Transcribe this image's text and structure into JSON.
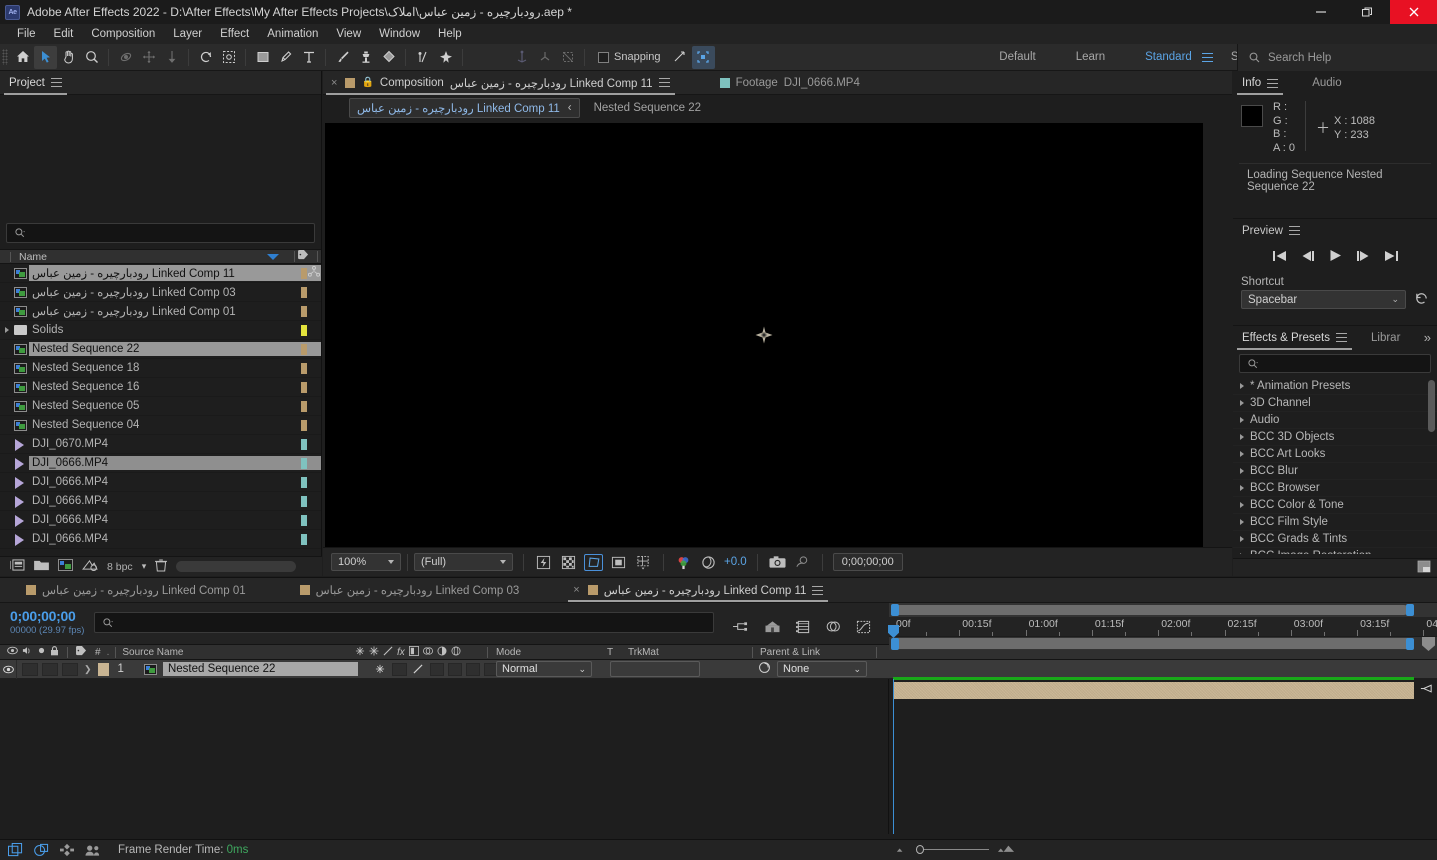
{
  "window": {
    "title": "Adobe After Effects 2022 - D:\\After Effects\\My After Effects Projects\\رودبارچیره - زمین عباس\\املاک.aep *",
    "logo": "Ae",
    "minimize": "—",
    "maximize": "❐",
    "close": "✕"
  },
  "menubar": {
    "items": [
      "File",
      "Edit",
      "Composition",
      "Layer",
      "Effect",
      "Animation",
      "View",
      "Window",
      "Help"
    ]
  },
  "toolbar": {
    "snapping_label": "Snapping",
    "workspaces": [
      "Default",
      "Learn",
      "Standard",
      "Small Screen"
    ],
    "selected_workspace": "Standard",
    "overflow": "»",
    "search_help_placeholder": "Search Help"
  },
  "project": {
    "tab_label": "Project",
    "search_placeholder": "",
    "column_name": "Name",
    "items": [
      {
        "name": "رودبارچیره - زمین عباس Linked Comp 11",
        "type": "comp",
        "selected": true,
        "color": "#b99b6b",
        "shared": true
      },
      {
        "name": "رودبارچیره - زمین عباس Linked Comp 03",
        "type": "comp",
        "selected": false,
        "color": "#b99b6b"
      },
      {
        "name": "رودبارچیره - زمین عباس Linked Comp 01",
        "type": "comp",
        "selected": false,
        "color": "#b99b6b"
      },
      {
        "name": "Solids",
        "type": "folder",
        "selected": false,
        "color": "#e3e33c"
      },
      {
        "name": "Nested Sequence 22",
        "type": "comp",
        "selected": true,
        "color": "#b99b6b"
      },
      {
        "name": "Nested Sequence 18",
        "type": "comp",
        "selected": false,
        "color": "#b99b6b"
      },
      {
        "name": "Nested Sequence 16",
        "type": "comp",
        "selected": false,
        "color": "#b99b6b"
      },
      {
        "name": "Nested Sequence 05",
        "type": "comp",
        "selected": false,
        "color": "#b99b6b"
      },
      {
        "name": "Nested Sequence 04",
        "type": "comp",
        "selected": false,
        "color": "#b99b6b"
      },
      {
        "name": "DJI_0670.MP4",
        "type": "video",
        "selected": false,
        "color": "#7fc2bf"
      },
      {
        "name": "DJI_0666.MP4",
        "type": "video",
        "selected": true,
        "color": "#7fc2bf"
      },
      {
        "name": "DJI_0666.MP4",
        "type": "video",
        "selected": false,
        "color": "#7fc2bf"
      },
      {
        "name": "DJI_0666.MP4",
        "type": "video",
        "selected": false,
        "color": "#7fc2bf"
      },
      {
        "name": "DJI_0666.MP4",
        "type": "video",
        "selected": false,
        "color": "#7fc2bf"
      },
      {
        "name": "DJI_0666.MP4",
        "type": "video",
        "selected": false,
        "color": "#7fc2bf"
      }
    ],
    "footer": {
      "bit_depth": "8 bpc"
    }
  },
  "composition": {
    "tabs": [
      {
        "prefix": "Composition",
        "label": "رودبارچیره - زمین عباس Linked Comp 11",
        "active": true,
        "closable": true,
        "swatch": "#b99b6b"
      },
      {
        "prefix": "Footage",
        "label": "DJI_0666.MP4",
        "active": false,
        "closable": false,
        "swatch": "#7fc2bf"
      }
    ],
    "breadcrumb_chip": "رودبارچیره - زمین عباس Linked Comp 11",
    "breadcrumb_sep": "‹",
    "breadcrumb_rest": "Nested Sequence 22",
    "bottom_bar": {
      "zoom": "100%",
      "resolution": "(Full)",
      "exposure": "+0.0",
      "timecode": "0;00;00;00"
    }
  },
  "info": {
    "tabs": [
      "Info",
      "Audio"
    ],
    "active_tab": "Info",
    "channels": [
      {
        "label": "R :",
        "value": ""
      },
      {
        "label": "G :",
        "value": ""
      },
      {
        "label": "B :",
        "value": ""
      },
      {
        "label": "A :",
        "value": "0"
      }
    ],
    "coords": {
      "x_label": "X :",
      "x_value": "1088",
      "y_label": "Y :",
      "y_value": "233"
    },
    "status": "Loading Sequence Nested Sequence 22"
  },
  "preview": {
    "tab_label": "Preview",
    "transport": [
      "first-frame",
      "prev-frame",
      "play",
      "next-frame",
      "last-frame"
    ],
    "shortcut_label": "Shortcut",
    "shortcut_value": "Spacebar"
  },
  "effects": {
    "tabs": [
      "Effects & Presets",
      "Librar"
    ],
    "active_tab": "Effects & Presets",
    "overflow": "»",
    "search_placeholder": "",
    "categories": [
      "* Animation Presets",
      "3D Channel",
      "Audio",
      "BCC 3D Objects",
      "BCC Art Looks",
      "BCC Blur",
      "BCC Browser",
      "BCC Color & Tone",
      "BCC Film Style",
      "BCC Grads & Tints",
      "BCC Image Restoration"
    ]
  },
  "timeline": {
    "tabs": [
      {
        "label": "رودبارچیره - زمین عباس Linked Comp 01",
        "active": false,
        "closable": false,
        "swatch": "#b99b6b"
      },
      {
        "label": "رودبارچیره - زمین عباس Linked Comp 03",
        "active": false,
        "closable": false,
        "swatch": "#b99b6b"
      },
      {
        "label": "رودبارچیره - زمین عباس Linked Comp 11",
        "active": true,
        "closable": true,
        "swatch": "#b99b6b"
      }
    ],
    "current_time": "0;00;00;00",
    "frame_info": "00000 (29.97 fps)",
    "search_placeholder": "",
    "columns": {
      "source_name": "Source Name",
      "mode": "Mode",
      "track_matte_t": "T",
      "track_matte": "TrkMat",
      "parent_link": "Parent & Link",
      "index": "#"
    },
    "layers": [
      {
        "index": "1",
        "name": "Nested Sequence 22",
        "mode": "Normal",
        "trkmat": "",
        "parent": "None",
        "label_color": "#c9b593",
        "visible": true
      }
    ],
    "ruler_labels": [
      "00f",
      "00:15f",
      "01:00f",
      "01:15f",
      "02:00f",
      "02:15f",
      "03:00f",
      "03:15f",
      "04"
    ]
  },
  "statusbar": {
    "frame_render_label": "Frame Render Time:",
    "frame_render_value": "0ms"
  }
}
